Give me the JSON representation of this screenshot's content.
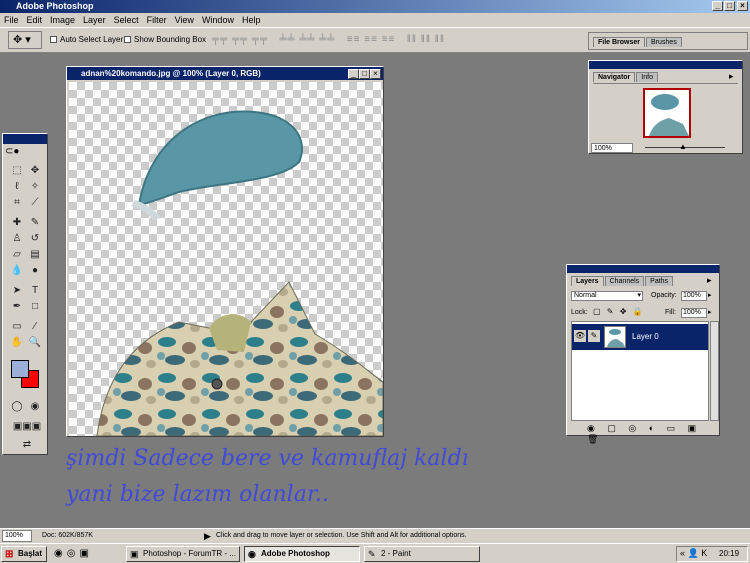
{
  "app": {
    "title": "Adobe Photoshop"
  },
  "menu": [
    "File",
    "Edit",
    "Image",
    "Layer",
    "Select",
    "Filter",
    "View",
    "Window",
    "Help"
  ],
  "options": {
    "auto_select_layer": "Auto Select Layer",
    "show_bounding_box": "Show Bounding Box",
    "file_browser_tab": "File Browser",
    "brushes_tab": "Brushes"
  },
  "document": {
    "title": "adnan%20komando.jpg @ 100% (Layer 0, RGB)"
  },
  "navigator": {
    "tabs": [
      "Navigator",
      "Info"
    ],
    "zoom": "100%"
  },
  "layers": {
    "tabs": [
      "Layers",
      "Channels",
      "Paths"
    ],
    "blend_mode": "Normal",
    "opacity_label": "Opacity:",
    "opacity": "100%",
    "lock_label": "Lock:",
    "fill_label": "Fill:",
    "fill": "100%",
    "layer_name": "Layer 0"
  },
  "overlay": {
    "line1": "şimdi Sadece bere ve kamuflaj kaldı",
    "line2": "yani bize lazım olanlar.."
  },
  "status": {
    "zoom": "100%",
    "doc": "Doc: 602K/857K",
    "hint": "Click and drag to move layer or selection.  Use Shift and Alt for additional options."
  },
  "taskbar": {
    "start": "Başlat",
    "tasks": [
      "Photoshop - ForumTR - ...",
      "Adobe Photoshop",
      "2 - Paint"
    ],
    "clock": "20:19"
  },
  "colors": {
    "foreground": "#9bb0d8",
    "background": "#ff0000",
    "layer_selected": "#0a246a"
  }
}
